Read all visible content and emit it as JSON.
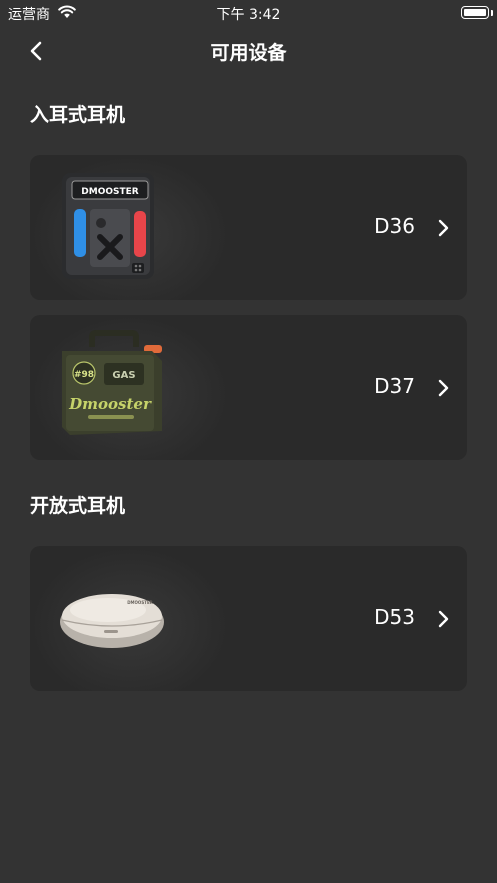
{
  "status_bar": {
    "carrier": "运营商",
    "time": "下午 3:42"
  },
  "nav": {
    "title": "可用设备",
    "back_icon": "chevron-left-icon"
  },
  "sections": [
    {
      "title": "入耳式耳机",
      "devices": [
        {
          "name": "D36",
          "image_label": "DMOOSTER"
        },
        {
          "name": "D37",
          "image_label": "#98 GAS Dmooster"
        }
      ]
    },
    {
      "title": "开放式耳机",
      "devices": [
        {
          "name": "D53",
          "image_label": "DMOOSTER"
        }
      ]
    }
  ],
  "colors": {
    "background": "#333333",
    "card": "#2a2a2a",
    "text": "#ffffff",
    "accent_red": "#e8454a",
    "accent_blue": "#2f8fe6"
  }
}
